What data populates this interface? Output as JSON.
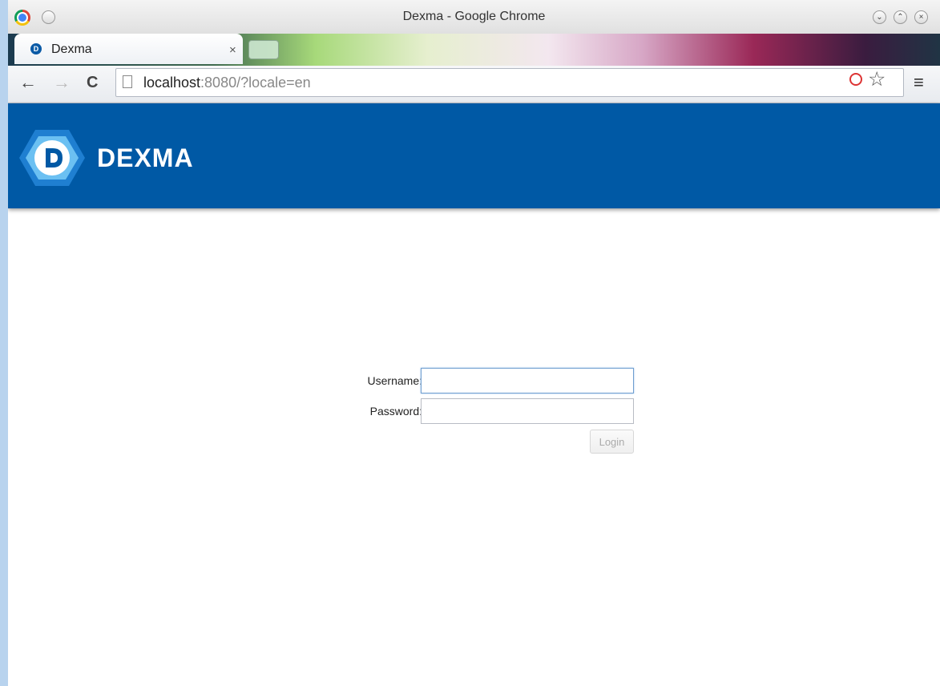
{
  "window": {
    "title": "Dexma - Google Chrome"
  },
  "tab": {
    "title": "Dexma",
    "close": "×"
  },
  "address_bar": {
    "host": "localhost",
    "rest": ":8080/?locale=en"
  },
  "toolbar": {
    "back": "←",
    "forward": "→",
    "reload": "C",
    "star": "☆",
    "menu": "≡"
  },
  "app": {
    "brand": "DEXMA"
  },
  "login": {
    "username_label": "Username:",
    "password_label": "Password:",
    "username_value": "",
    "password_value": "",
    "login_label": "Login"
  },
  "colors": {
    "header_bg": "#0059a5",
    "accent": "#2f8ad8"
  }
}
